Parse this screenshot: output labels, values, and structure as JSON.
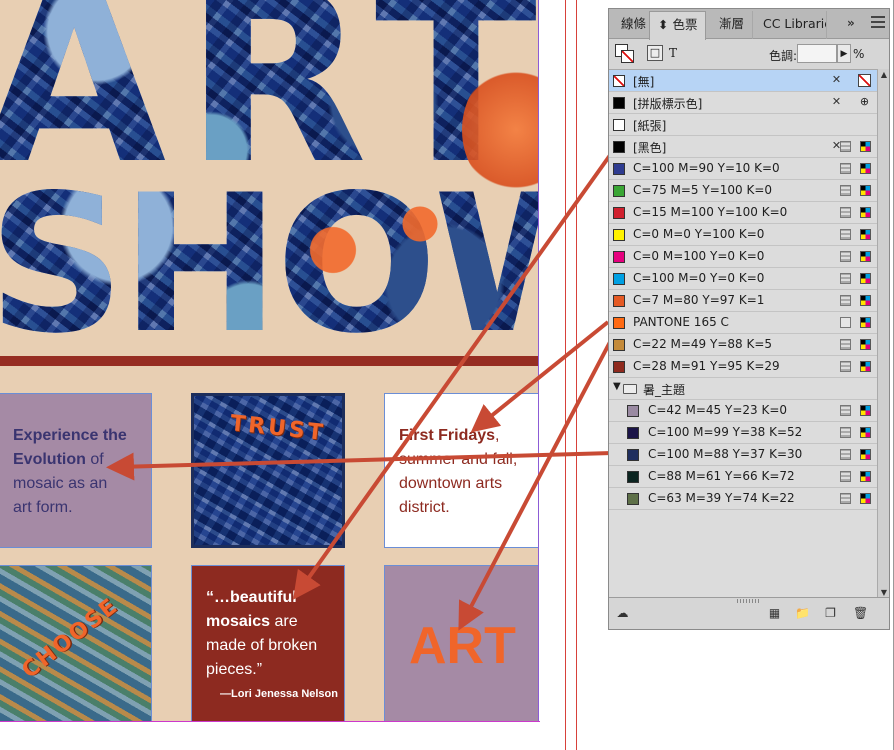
{
  "document": {
    "title_line1": "ART",
    "title_line2": "SHOW",
    "tile_experience": {
      "bold1": "Experience the",
      "bold2": "Evolution",
      "rest1": " of",
      "rest2": "mosaic as an",
      "rest3": "art form."
    },
    "tile_trust_label": "TRUST",
    "tile_fridays": {
      "bold": "First Fridays",
      "rest1": ",",
      "rest2": "summer and fall,",
      "rest3": "downtown arts",
      "rest4": "district."
    },
    "tile_choose_label": "CHOOSE",
    "tile_quote": {
      "line1_bold": "“…beautiful",
      "line2_bold": "mosaics",
      "line2_rest": " are",
      "line3": "made of broken",
      "line4": "pieces.”",
      "attribution": "—Lori Jenessa Nelson"
    },
    "tile_art_label": "ART",
    "colors": {
      "page_bg": "#e8cfb3",
      "accent_red": "#962d22",
      "orange": "#f0652a",
      "purple_tile": "#a58aa5",
      "text_blue": "#3a3a7a"
    }
  },
  "panel": {
    "tabs": [
      {
        "label": "線條",
        "active": false
      },
      {
        "label": "⬍ 色票",
        "active": true
      },
      {
        "label": "漸層",
        "active": false
      },
      {
        "label": "CC Librarie",
        "active": false
      }
    ],
    "more_label": "»",
    "tint_label": "色調:",
    "tint_value": "",
    "tint_unit": "%",
    "t_label": "T",
    "swatches": [
      {
        "name": "[無]",
        "color": "none",
        "selected": true,
        "locked": true,
        "type_icon": "none-icon"
      },
      {
        "name": "[拼版標示色]",
        "color": "#000000",
        "locked": true,
        "type_icon": "registration-icon"
      },
      {
        "name": "[紙張]",
        "color": "#ffffff"
      },
      {
        "name": "[黑色]",
        "color": "#000000",
        "locked": true,
        "type_icon": "cmyk-icon",
        "process": true
      },
      {
        "name": "C=100 M=90 Y=10 K=0",
        "color": "#2e3b8f",
        "process": true,
        "type_icon": "cmyk-icon"
      },
      {
        "name": "C=75 M=5 Y=100 K=0",
        "color": "#3aa635",
        "process": true,
        "type_icon": "cmyk-icon"
      },
      {
        "name": "C=15 M=100 Y=100 K=0",
        "color": "#d0202e",
        "process": true,
        "type_icon": "cmyk-icon"
      },
      {
        "name": "C=0 M=0 Y=100 K=0",
        "color": "#fff200",
        "process": true,
        "type_icon": "cmyk-icon"
      },
      {
        "name": "C=0 M=100 Y=0 K=0",
        "color": "#e5007e",
        "process": true,
        "type_icon": "cmyk-icon"
      },
      {
        "name": "C=100 M=0 Y=0 K=0",
        "color": "#00a0e3",
        "process": true,
        "type_icon": "cmyk-icon"
      },
      {
        "name": "C=7 M=80 Y=97 K=1",
        "color": "#e55a24",
        "process": true,
        "type_icon": "cmyk-icon"
      },
      {
        "name": "PANTONE 165 C",
        "color": "#ff6a13",
        "spot": true,
        "type_icon": "spot-icon"
      },
      {
        "name": "C=22 M=49 Y=88 K=5",
        "color": "#c48a3a",
        "process": true,
        "type_icon": "cmyk-icon"
      },
      {
        "name": "C=28 M=91 Y=95 K=29",
        "color": "#8f2a1e",
        "process": true,
        "type_icon": "cmyk-icon"
      }
    ],
    "group": {
      "name": "暑_主題",
      "expanded": true
    },
    "group_swatches": [
      {
        "name": "C=42 M=45 Y=23 K=0",
        "color": "#9a8aa2"
      },
      {
        "name": "C=100 M=99 Y=38 K=52",
        "color": "#1b1448"
      },
      {
        "name": "C=100 M=88 Y=37 K=30",
        "color": "#1f2e5e"
      },
      {
        "name": "C=88 M=61 Y=66 K=72",
        "color": "#0b2420"
      },
      {
        "name": "C=63 M=39 Y=74 K=22",
        "color": "#5e7048"
      }
    ],
    "footer_icons": [
      "cloud-icon",
      "view-options-icon",
      "new-group-icon",
      "new-swatch-icon",
      "delete-icon"
    ]
  }
}
